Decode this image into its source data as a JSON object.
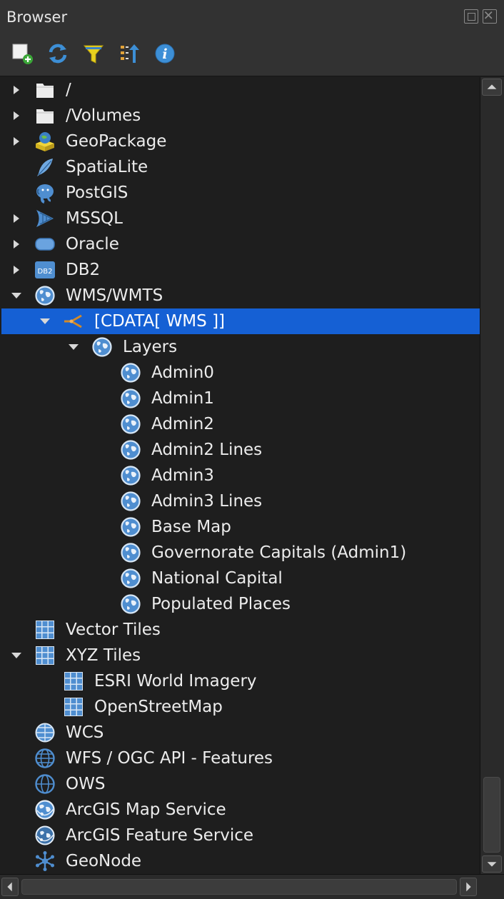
{
  "panel": {
    "title": "Browser"
  },
  "toolbar": {
    "buttons": [
      {
        "name": "add-layer-icon"
      },
      {
        "name": "refresh-icon"
      },
      {
        "name": "filter-icon"
      },
      {
        "name": "collapse-all-icon"
      },
      {
        "name": "info-icon"
      }
    ]
  },
  "tree": {
    "rows": [
      {
        "label": "/",
        "depth": 0,
        "arrow": "right",
        "icon": "folder-icon"
      },
      {
        "label": "/Volumes",
        "depth": 0,
        "arrow": "right",
        "icon": "folder-icon"
      },
      {
        "label": "GeoPackage",
        "depth": 0,
        "arrow": "right",
        "icon": "geopackage-icon"
      },
      {
        "label": "SpatiaLite",
        "depth": 0,
        "arrow": "none",
        "icon": "spatialite-feather-icon"
      },
      {
        "label": "PostGIS",
        "depth": 0,
        "arrow": "none",
        "icon": "postgis-elephant-icon"
      },
      {
        "label": "MSSQL",
        "depth": 0,
        "arrow": "right",
        "icon": "mssql-icon"
      },
      {
        "label": "Oracle",
        "depth": 0,
        "arrow": "right",
        "icon": "oracle-icon"
      },
      {
        "label": "DB2",
        "depth": 0,
        "arrow": "right",
        "icon": "db2-icon"
      },
      {
        "label": "WMS/WMTS",
        "depth": 0,
        "arrow": "down",
        "icon": "wms-globe-icon"
      },
      {
        "label": "[CDATA[ WMS ]]",
        "depth": 1,
        "arrow": "down",
        "icon": "connection-icon",
        "selected": true
      },
      {
        "label": "Layers",
        "depth": 2,
        "arrow": "down",
        "icon": "wms-globe-icon"
      },
      {
        "label": "Admin0",
        "depth": 3,
        "arrow": "none",
        "icon": "wms-globe-icon"
      },
      {
        "label": "Admin1",
        "depth": 3,
        "arrow": "none",
        "icon": "wms-globe-icon"
      },
      {
        "label": "Admin2",
        "depth": 3,
        "arrow": "none",
        "icon": "wms-globe-icon"
      },
      {
        "label": "Admin2 Lines",
        "depth": 3,
        "arrow": "none",
        "icon": "wms-globe-icon"
      },
      {
        "label": "Admin3",
        "depth": 3,
        "arrow": "none",
        "icon": "wms-globe-icon"
      },
      {
        "label": "Admin3 Lines",
        "depth": 3,
        "arrow": "none",
        "icon": "wms-globe-icon"
      },
      {
        "label": "Base Map",
        "depth": 3,
        "arrow": "none",
        "icon": "wms-globe-icon"
      },
      {
        "label": "Governorate Capitals (Admin1)",
        "depth": 3,
        "arrow": "none",
        "icon": "wms-globe-icon"
      },
      {
        "label": "National Capital",
        "depth": 3,
        "arrow": "none",
        "icon": "wms-globe-icon"
      },
      {
        "label": "Populated Places",
        "depth": 3,
        "arrow": "none",
        "icon": "wms-globe-icon"
      },
      {
        "label": "Vector Tiles",
        "depth": 0,
        "arrow": "none",
        "icon": "grid-tiles-icon"
      },
      {
        "label": "XYZ Tiles",
        "depth": 0,
        "arrow": "down",
        "icon": "grid-tiles-icon"
      },
      {
        "label": "ESRI World Imagery",
        "depth": 1,
        "arrow": "none",
        "icon": "grid-tiles-icon"
      },
      {
        "label": "OpenStreetMap",
        "depth": 1,
        "arrow": "none",
        "icon": "grid-tiles-icon"
      },
      {
        "label": "WCS",
        "depth": 0,
        "arrow": "none",
        "icon": "wcs-globe-icon"
      },
      {
        "label": "WFS / OGC API - Features",
        "depth": 0,
        "arrow": "none",
        "icon": "wfs-globe-icon"
      },
      {
        "label": "OWS",
        "depth": 0,
        "arrow": "none",
        "icon": "ows-globe-icon"
      },
      {
        "label": "ArcGIS Map Service",
        "depth": 0,
        "arrow": "none",
        "icon": "arcgis-map-icon"
      },
      {
        "label": "ArcGIS Feature Service",
        "depth": 0,
        "arrow": "none",
        "icon": "arcgis-feature-icon"
      },
      {
        "label": "GeoNode",
        "depth": 0,
        "arrow": "none",
        "icon": "geonode-icon"
      }
    ]
  },
  "colors": {
    "selection": "#1560d4",
    "background": "#1e1e1e",
    "panel": "#323232"
  }
}
